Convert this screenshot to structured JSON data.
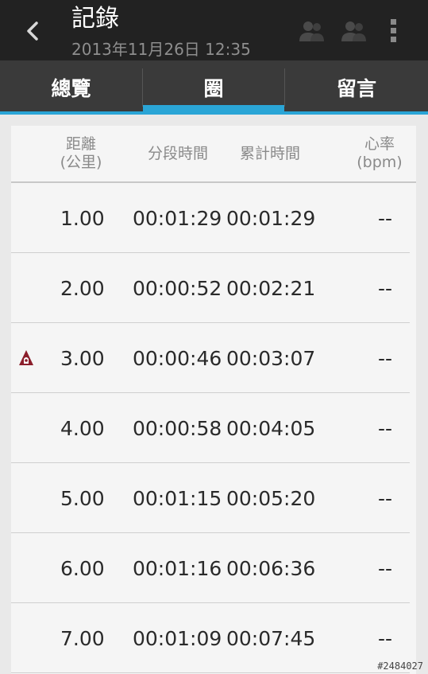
{
  "actionbar": {
    "title": "記錄",
    "subtitle": "2013年11月26日 12:35"
  },
  "tabs": [
    {
      "label": "總覽",
      "selected": false
    },
    {
      "label": "圈",
      "selected": true
    },
    {
      "label": "留言",
      "selected": false
    }
  ],
  "table": {
    "headers": {
      "distance": [
        "距離",
        "(公里)"
      ],
      "split": "分段時間",
      "total": "累計時間",
      "heart_rate": [
        "心率",
        "(bpm)"
      ]
    },
    "rows": [
      {
        "distance": "1.00",
        "split": "00:01:29",
        "total": "00:01:29",
        "hr": "--",
        "marker": false
      },
      {
        "distance": "2.00",
        "split": "00:00:52",
        "total": "00:02:21",
        "hr": "--",
        "marker": false
      },
      {
        "distance": "3.00",
        "split": "00:00:46",
        "total": "00:03:07",
        "hr": "--",
        "marker": true
      },
      {
        "distance": "4.00",
        "split": "00:00:58",
        "total": "00:04:05",
        "hr": "--",
        "marker": false
      },
      {
        "distance": "5.00",
        "split": "00:01:15",
        "total": "00:05:20",
        "hr": "--",
        "marker": false
      },
      {
        "distance": "6.00",
        "split": "00:01:16",
        "total": "00:06:36",
        "hr": "--",
        "marker": false
      },
      {
        "distance": "7.00",
        "split": "00:01:09",
        "total": "00:07:45",
        "hr": "--",
        "marker": false
      }
    ]
  },
  "colors": {
    "accent": "#2aa5d6",
    "actionbar": "#222222",
    "tabbar": "#3a3a3a",
    "marker": "#8b1e2b"
  },
  "watermark": "#2484027"
}
